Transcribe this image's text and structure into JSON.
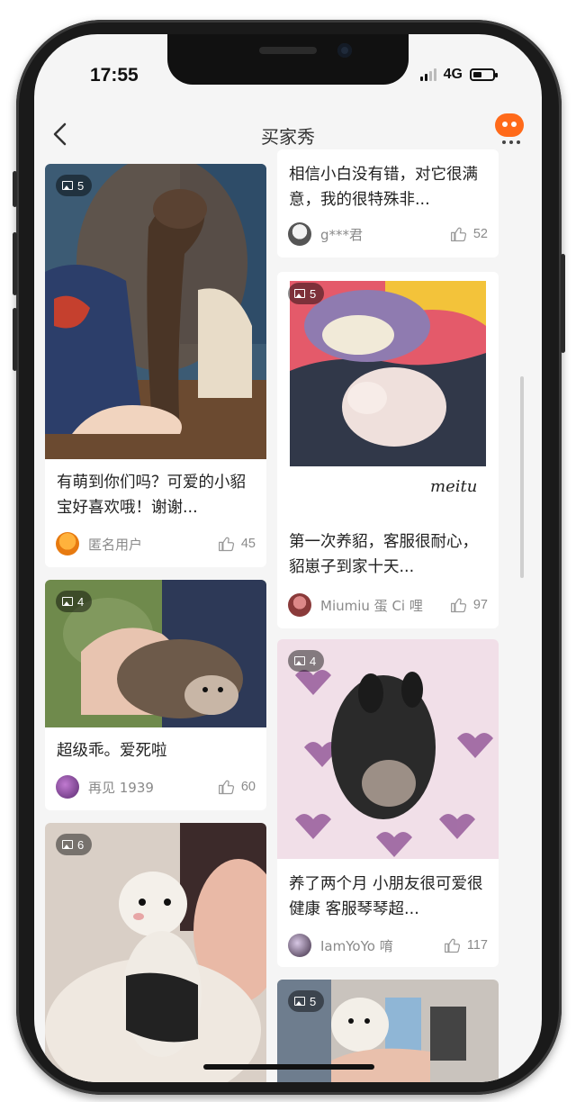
{
  "status": {
    "time": "17:55",
    "network": "4G"
  },
  "nav": {
    "title": "买家秀"
  },
  "left_cards": [
    {
      "photos": "5",
      "desc": "有萌到你们吗？可爱的小貂宝好喜欢哦！谢谢...",
      "user": "匿名用户",
      "likes": "45"
    },
    {
      "photos": "4",
      "desc": "超级乖。爱死啦",
      "user": "再见 1939",
      "likes": "60"
    },
    {
      "photos": "6"
    }
  ],
  "right_cards": [
    {
      "desc": "相信小白没有错，对它很满意，我的很特殊非...",
      "user": "g***君",
      "likes": "52"
    },
    {
      "photos": "5",
      "watermark": "meitu",
      "desc": "第一次养貂，客服很耐心，貂崽子到家十天...",
      "user": "Miumiu 蛋 Ci 哩",
      "likes": "97"
    },
    {
      "photos": "4",
      "desc": "养了两个月 小朋友很可爱很健康 客服琴琴超...",
      "user": "IamYoYo 唷",
      "likes": "117"
    },
    {
      "photos": "5"
    }
  ],
  "colors": {
    "accent": "#ff6a1a",
    "background": "#f5f5f5",
    "muted_text": "#8a8a8a"
  },
  "icons": [
    "back-icon",
    "menu-icon",
    "photo-count-icon",
    "thumbs-up-icon"
  ]
}
